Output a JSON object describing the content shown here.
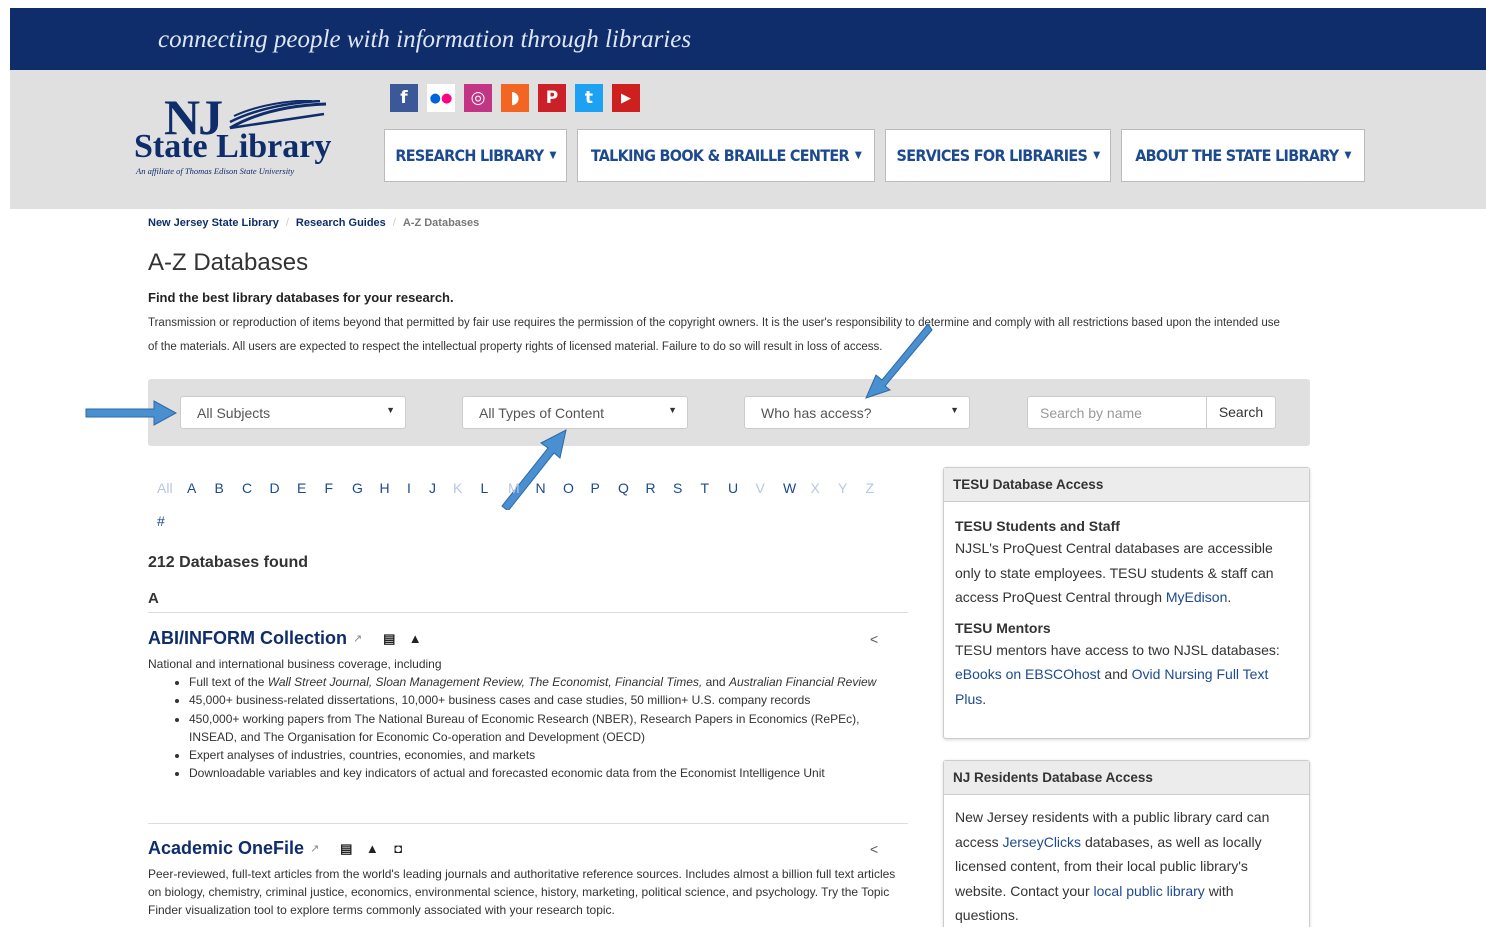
{
  "header": {
    "tagline": "connecting people with information through libraries",
    "logo": {
      "nj": "NJ",
      "state_library": "State Library",
      "affiliate": "An affiliate of Thomas Edison State University"
    },
    "social": [
      {
        "icon": "facebook-icon",
        "glyph": "f",
        "color": "#3b5998"
      },
      {
        "icon": "flickr-icon",
        "glyph": "••",
        "color": "#ffffff"
      },
      {
        "icon": "instagram-icon",
        "glyph": "◎",
        "color": "#c13584"
      },
      {
        "icon": "rss-icon",
        "glyph": "◗",
        "color": "#f26522"
      },
      {
        "icon": "pinterest-icon",
        "glyph": "P",
        "color": "#cb2027"
      },
      {
        "icon": "twitter-icon",
        "glyph": "t",
        "color": "#1da1f2"
      },
      {
        "icon": "youtube-icon",
        "glyph": "▶",
        "color": "#cd201f"
      }
    ],
    "nav": [
      {
        "label": "RESEARCH LIBRARY"
      },
      {
        "label": "TALKING BOOK & BRAILLE CENTER"
      },
      {
        "label": "SERVICES FOR LIBRARIES"
      },
      {
        "label": "ABOUT THE STATE LIBRARY"
      }
    ]
  },
  "breadcrumb": {
    "home": "New Jersey State Library",
    "guides": "Research Guides",
    "current": "A-Z Databases"
  },
  "page": {
    "title": "A-Z Databases",
    "subtitle": "Find the best library databases for your research.",
    "notice": "Transmission or reproduction of items beyond that permitted by fair use requires the permission of the copyright owners. It is the user's responsibility to determine and comply with all restrictions based upon the intended use of the materials. All users are expected to respect the intellectual property rights of licensed material. Failure to do so will result in loss of access."
  },
  "filters": {
    "subjects": "All Subjects",
    "types": "All Types of Content",
    "access": "Who has access?",
    "search_placeholder": "Search by name",
    "search_button": "Search"
  },
  "alphabet": {
    "letters": [
      "All",
      "A",
      "B",
      "C",
      "D",
      "E",
      "F",
      "G",
      "H",
      "I",
      "J",
      "K",
      "L",
      "M",
      "N",
      "O",
      "P",
      "Q",
      "R",
      "S",
      "T",
      "U",
      "V",
      "W",
      "X",
      "Y",
      "Z"
    ],
    "disabled": [
      "All",
      "K",
      "M",
      "V",
      "X",
      "Y",
      "Z"
    ],
    "hash": "#"
  },
  "results": {
    "count": "212 Databases found",
    "letter": "A",
    "databases": [
      {
        "title": "ABI/INFORM Collection",
        "intro": "National and international business coverage, including",
        "bullets": [
          "Full text of the Wall Street Journal, Sloan Management Review, The Economist, Financial Times, and Australian Financial Review",
          "45,000+ business-related dissertations, 10,000+ business cases and case studies, 50 million+ U.S. company records",
          "450,000+ working papers from The National Bureau of Economic Research (NBER), Research Papers in Economics (RePEc), INSEAD, and The Organisation for Economic Co-operation and Development (OECD)",
          "Expert analyses of industries, countries, economies, and markets",
          "Downloadable variables and key indicators of actual and forecasted economic data from the Economist Intelligence Unit"
        ]
      },
      {
        "title": "Academic OneFile",
        "intro": "Peer-reviewed, full-text articles from the world's leading journals and authoritative reference sources. Includes almost a billion full text articles on biology, chemistry, criminal justice, economics, environmental science, history, marketing, political science, and psychology. Try the Topic Finder visualization tool to explore terms commonly associated with your research topic."
      }
    ]
  },
  "sidebar": {
    "tesu": {
      "heading": "TESU Database Access",
      "students_heading": "TESU Students and Staff",
      "students_text": "NJSL's ProQuest Central databases are accessible only to state employees. TESU students & staff can access ProQuest Central through",
      "students_link": "MyEdison",
      "mentors_heading": "TESU Mentors",
      "mentors_text": "TESU mentors have access to two NJSL databases:",
      "mentors_link1": "eBooks on EBSCOhost",
      "mentors_and": "and",
      "mentors_link2": "Ovid Nursing Full Text Plus"
    },
    "nj": {
      "heading": "NJ Residents Database Access",
      "text1": "New Jersey residents with a public library card can access",
      "link1": "JerseyClicks",
      "text2": "databases, as well as locally licensed content,  from their local public library's website.  Contact your",
      "link2": "local public library",
      "text3": "with questions."
    }
  },
  "colors": {
    "brand": "#0f2d6b",
    "link": "#1d4a8f",
    "arrow": "#4a8fd0"
  }
}
